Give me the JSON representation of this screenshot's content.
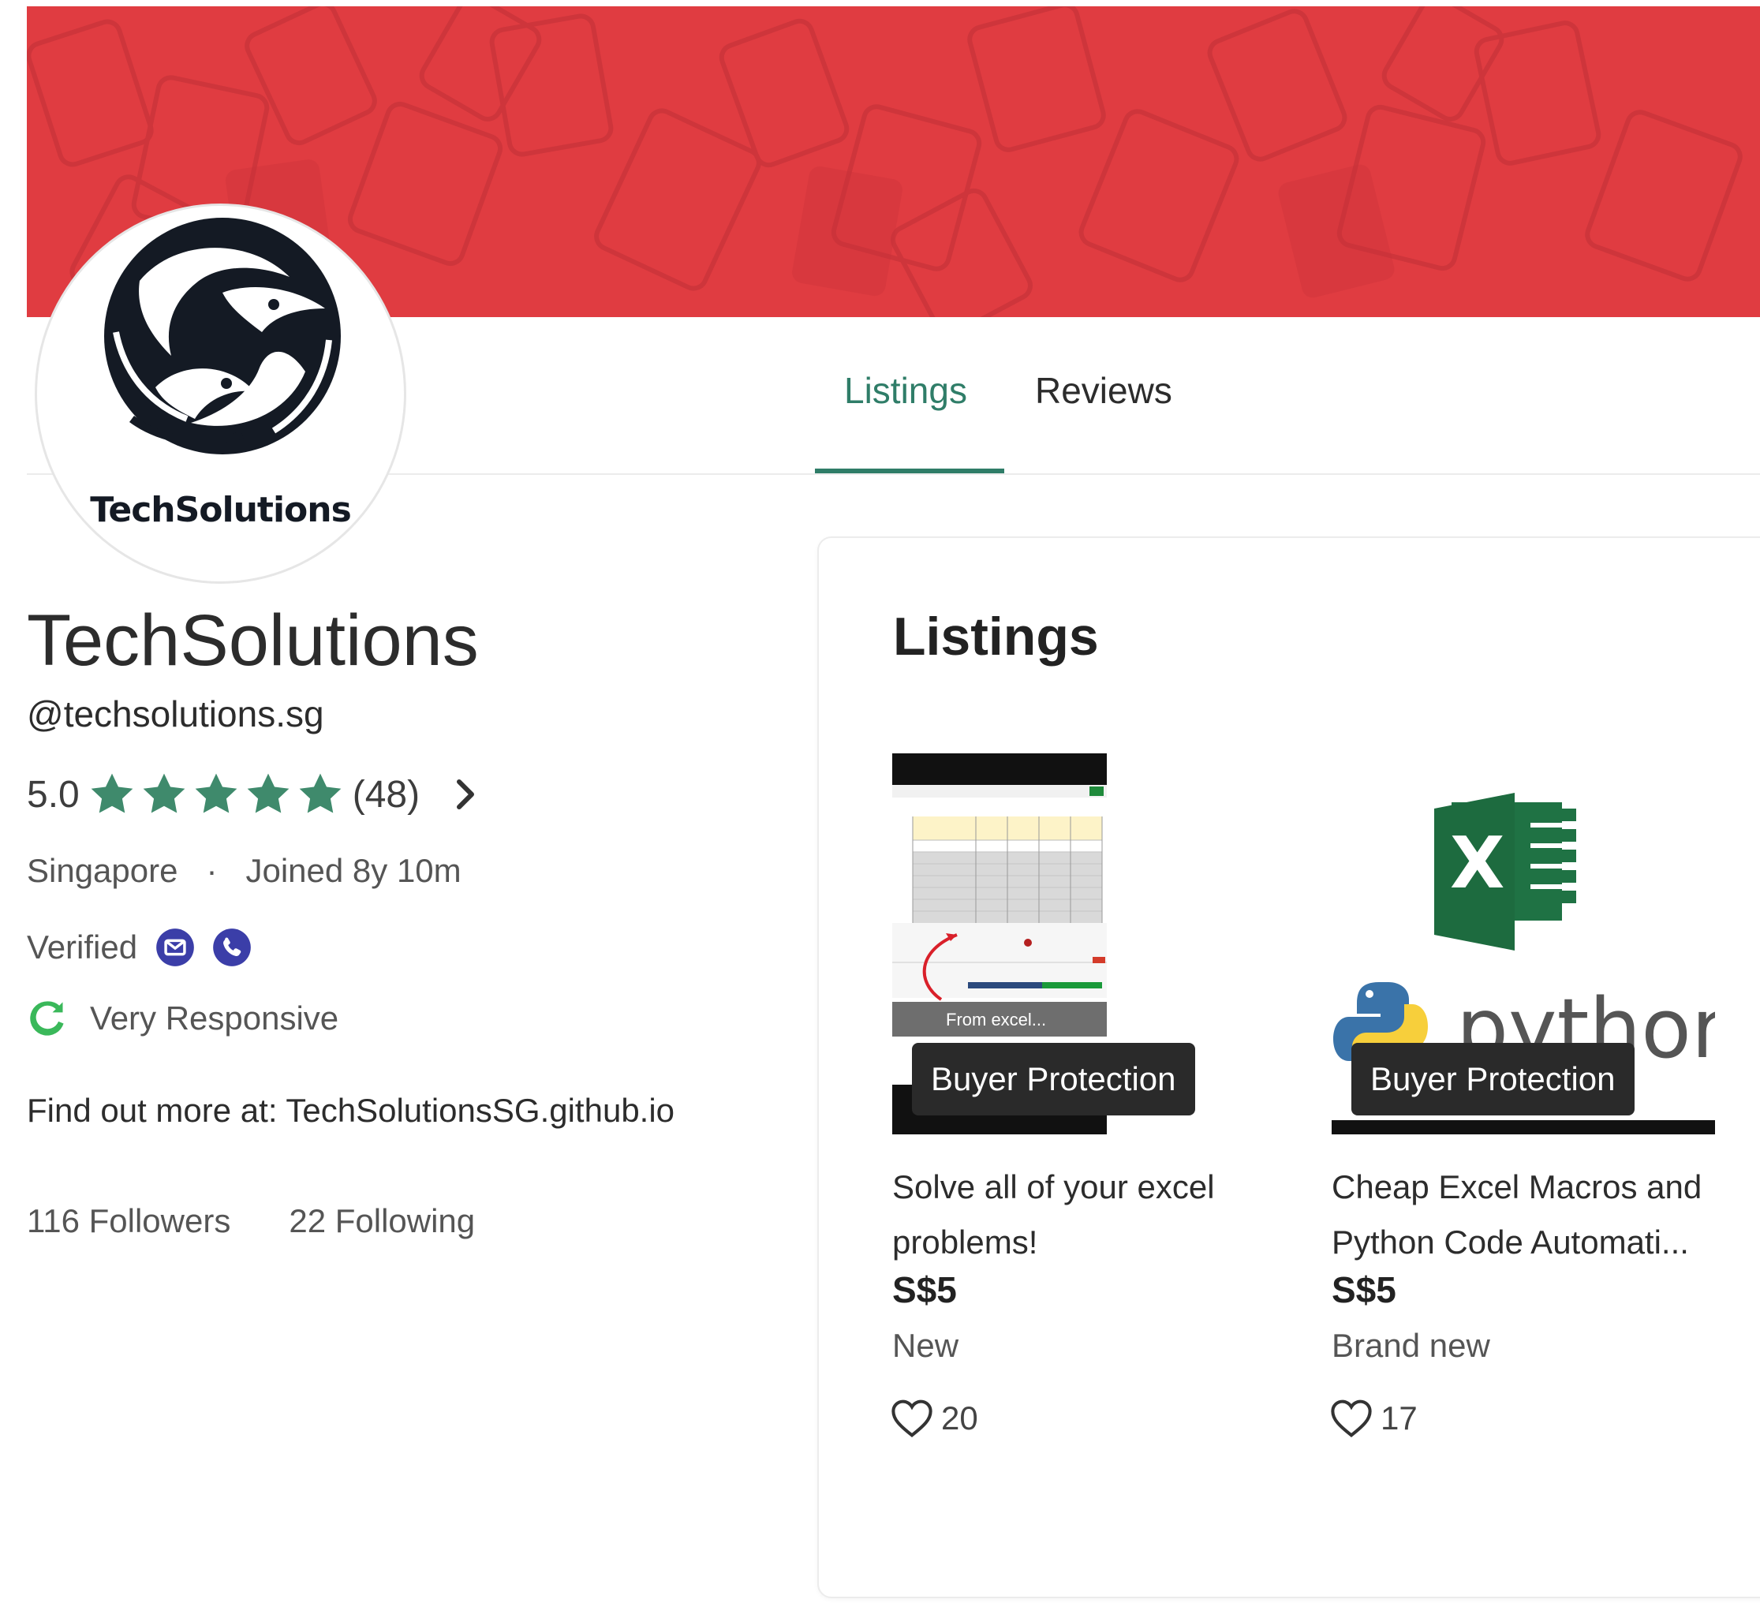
{
  "colors": {
    "banner": "#e03c41",
    "accent": "#2f7d68",
    "star": "#3f8a6c",
    "verify_icon": "#3b3ea8",
    "responsive_icon": "#3ab85a",
    "badge_bg": "#2a2a2a"
  },
  "avatar": {
    "caption": "TechSolutions"
  },
  "tabs": {
    "listings": "Listings",
    "reviews": "Reviews",
    "active": "Listings"
  },
  "profile": {
    "name": "TechSolutions",
    "handle": "@techsolutions.sg",
    "rating": "5.0",
    "rating_count": "(48)",
    "star_count": 5,
    "location": "Singapore",
    "separator": "·",
    "joined": "Joined 8y 10m",
    "verified_label": "Verified",
    "verified_icons": [
      "email-icon",
      "phone-icon"
    ],
    "responsiveness": "Very Responsive",
    "about": "Find out more at: TechSolutionsSG.github.io",
    "followers": "116 Followers",
    "following": "22 Following"
  },
  "listings": {
    "title": "Listings",
    "items": [
      {
        "thumb_caption": "From excel...",
        "badge": "Buyer Protection",
        "title_line1": "Solve all of your excel",
        "title_line2": "problems!",
        "price": "S$5",
        "condition": "New",
        "likes": "20"
      },
      {
        "thumb_text": "python",
        "badge": "Buyer Protection",
        "title_line1": "Cheap Excel Macros and",
        "title_line2": "Python Code Automati...",
        "price": "S$5",
        "condition": "Brand new",
        "likes": "17"
      }
    ]
  }
}
